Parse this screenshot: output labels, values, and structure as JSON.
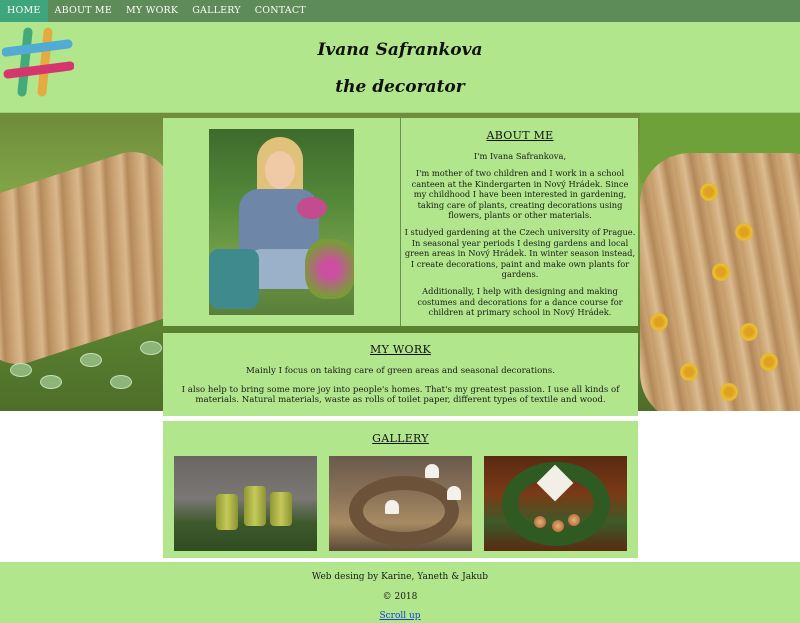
{
  "nav": {
    "items": [
      {
        "label": "HOME",
        "active": true
      },
      {
        "label": "ABOUT ME",
        "active": false
      },
      {
        "label": "MY WORK",
        "active": false
      },
      {
        "label": "GALLERY",
        "active": false
      },
      {
        "label": "CONTACT",
        "active": false
      }
    ]
  },
  "header": {
    "name": "Ivana Safrankova",
    "tagline": "the decorator",
    "logo_icon": "hashtag-logo-icon"
  },
  "about": {
    "heading": "ABOUT ME",
    "greeting": "I'm Ivana Safrankova,",
    "paragraphs": [
      "I'm mother of two children and I work in a school canteen at the Kindergarten in Nový Hrádek. Since my childhood I have been interested in gardening, taking care of plants, creating decorations using flowers, plants or other materials.",
      "I studyed gardening at the Czech university of Prague. In seasonal year periods I desing gardens and local green areas in Nový Hrádek. In winter season instead, I create decorations, paint and make own plants for gardens.",
      "Additionally, I help with designing and making costumes and decorations for a dance course for children at primary school in Nový Hrádek."
    ]
  },
  "mywork": {
    "heading": "MY WORK",
    "paragraphs": [
      "Mainly I focus on taking care of green areas and seasonal decorations.",
      "I also help to bring some more joy into people's homes. That's my greatest passion. I use all kinds of materials. Natural materials, waste as rolls of toilet paper, different types of textile and wood."
    ]
  },
  "gallery": {
    "heading": "GALLERY"
  },
  "footer": {
    "credit": "Web desing by Karine, Yaneth & Jakub",
    "copyright": "© 2018",
    "scroll_link": "Scroll up"
  },
  "colors": {
    "nav_bg": "#5e8c58",
    "nav_active": "#3ea57d",
    "panel_green": "#b1e68c",
    "link_blue": "#1a3fcf"
  }
}
